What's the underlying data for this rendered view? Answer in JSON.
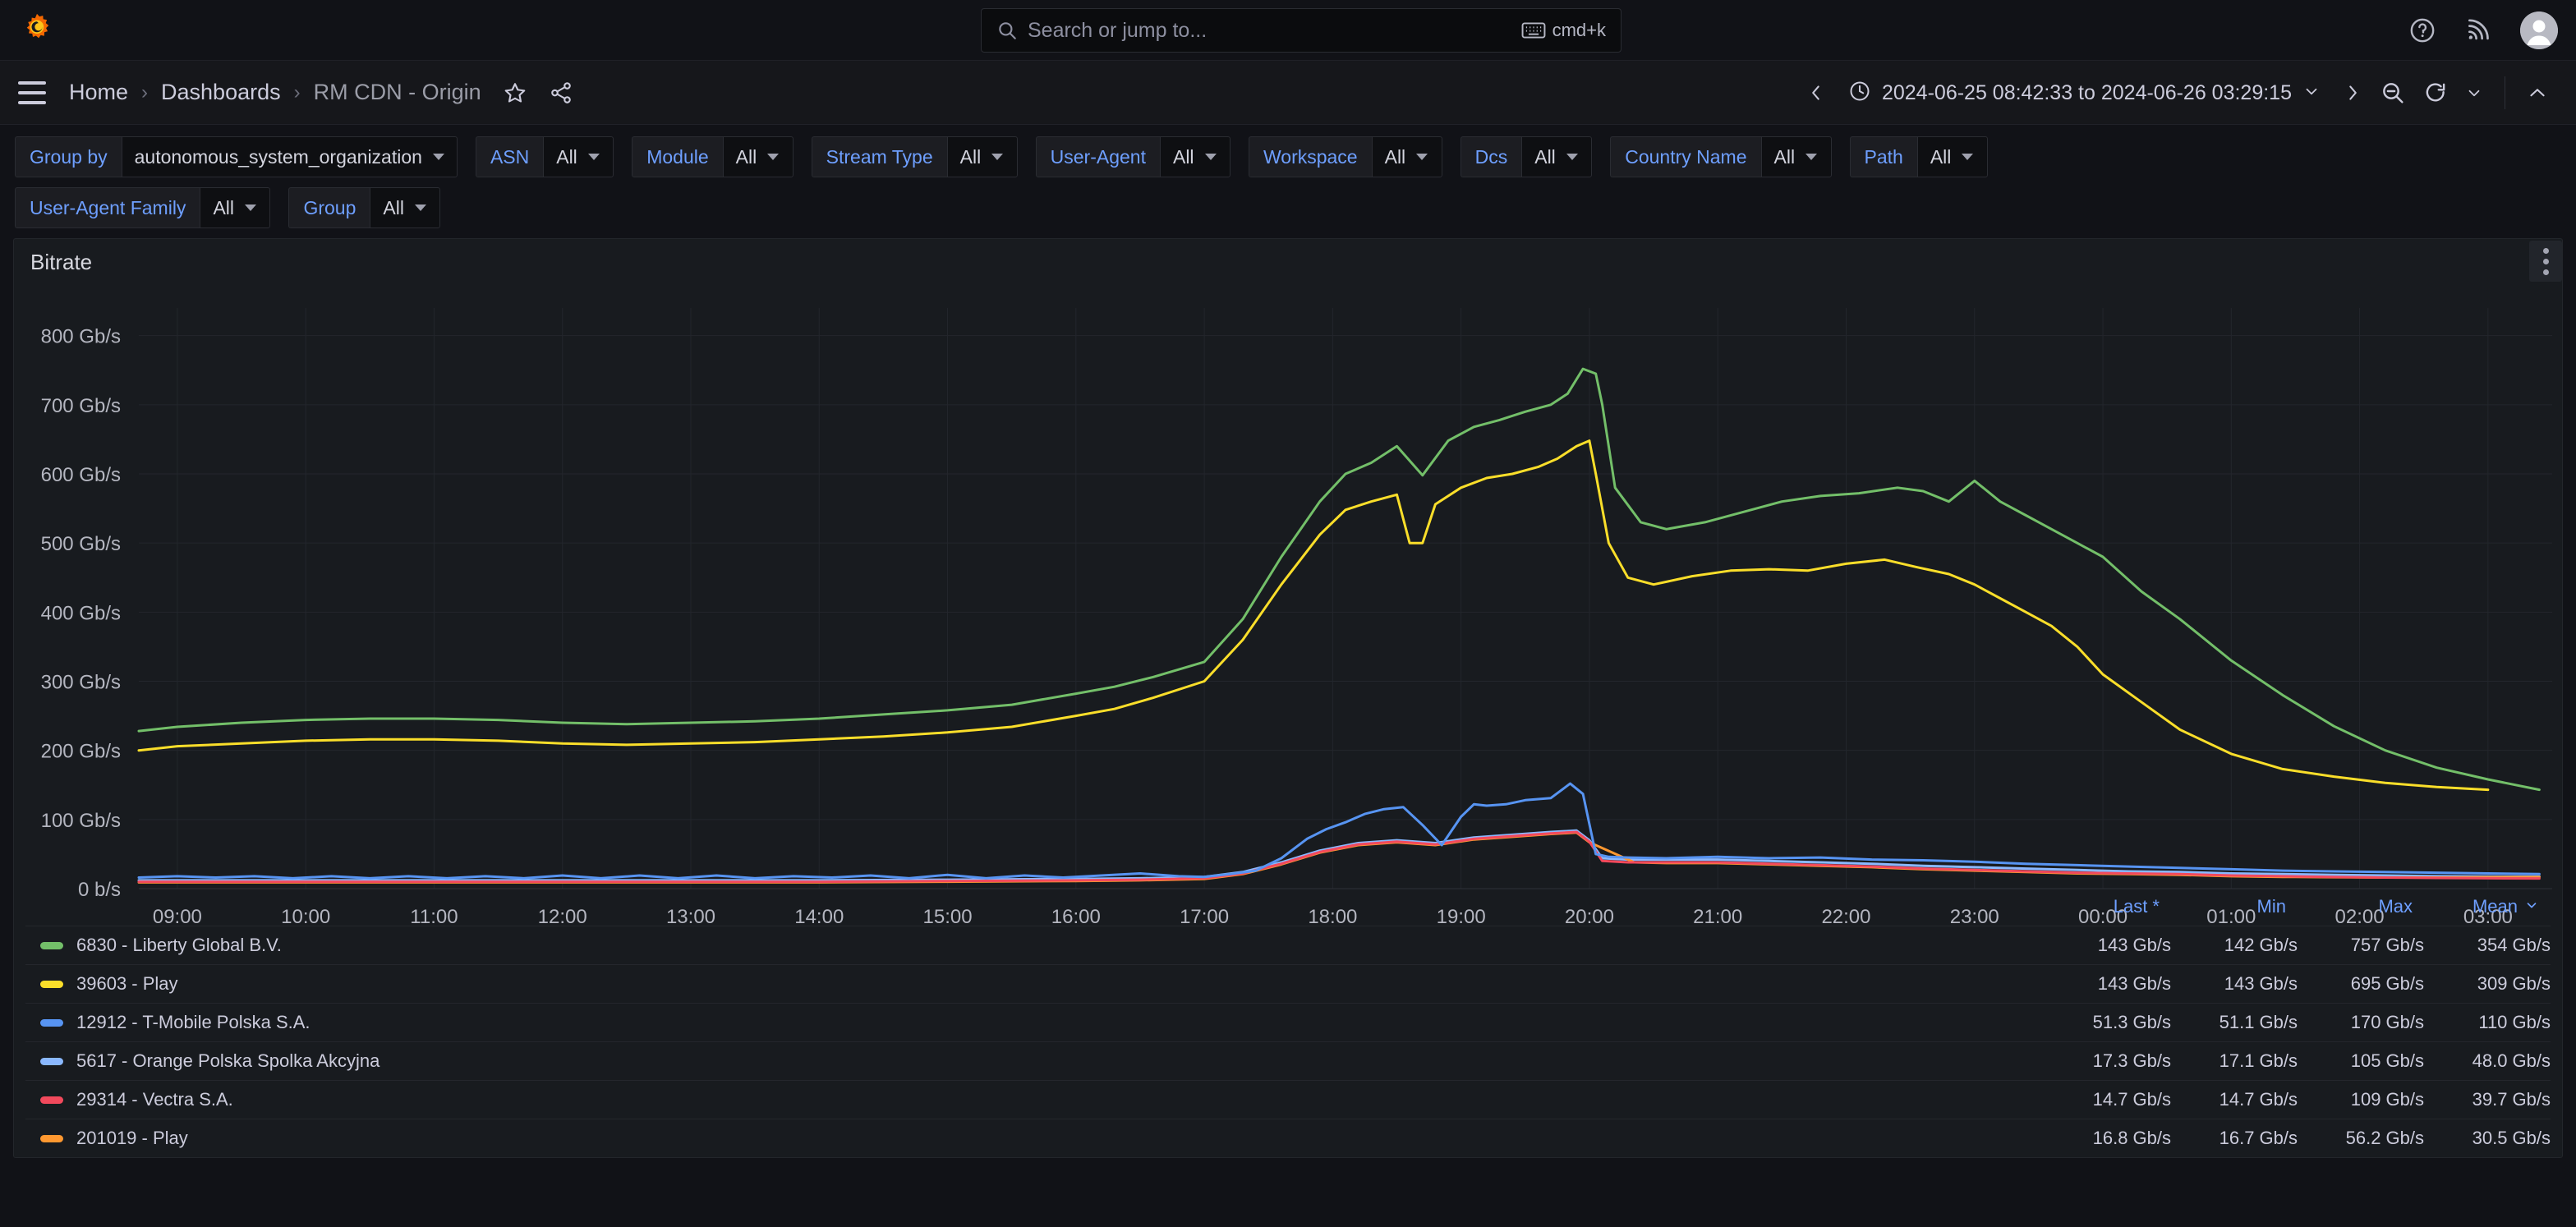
{
  "topnav": {
    "logo_icon": "grafana-logo-icon",
    "search": {
      "placeholder": "Search or jump to...",
      "shortcut": "cmd+k",
      "icon": "search-icon",
      "kbd_icon": "keyboard-icon"
    },
    "help_icon": "help-circle-icon",
    "news_icon": "rss-news-icon",
    "avatar_icon": "user-avatar-icon"
  },
  "breadcrumb": {
    "menu_icon": "hamburger-menu-icon",
    "items": [
      {
        "label": "Home"
      },
      {
        "label": "Dashboards"
      },
      {
        "label": "RM CDN - Origin"
      }
    ],
    "separator": "›",
    "star_icon": "star-outline-icon",
    "share_icon": "share-nodes-icon"
  },
  "timebar": {
    "prev_icon": "chevron-left-icon",
    "next_icon": "chevron-right-icon",
    "clock_icon": "clock-icon",
    "range": "2024-06-25 08:42:33 to 2024-06-26 03:29:15",
    "range_caret_icon": "chevron-down-icon",
    "zoom_out_icon": "zoom-out-icon",
    "refresh_icon": "refresh-icon",
    "refresh_caret_icon": "chevron-down-icon",
    "collapse_icon": "chevron-up-icon"
  },
  "variables": {
    "row1": [
      {
        "label": "Group by",
        "value": "autonomous_system_organization"
      },
      {
        "label": "ASN",
        "value": "All"
      },
      {
        "label": "Module",
        "value": "All"
      },
      {
        "label": "Stream Type",
        "value": "All"
      },
      {
        "label": "User-Agent",
        "value": "All"
      },
      {
        "label": "Workspace",
        "value": "All"
      },
      {
        "label": "Dcs",
        "value": "All"
      },
      {
        "label": "Country Name",
        "value": "All"
      },
      {
        "label": "Path",
        "value": "All"
      }
    ],
    "row2": [
      {
        "label": "User-Agent Family",
        "value": "All"
      },
      {
        "label": "Group",
        "value": "All"
      }
    ]
  },
  "panel": {
    "title": "Bitrate",
    "menu_icon": "panel-menu-kebab-icon"
  },
  "legend": {
    "columns": [
      "Last *",
      "Min",
      "Max",
      "Mean"
    ],
    "sort_caret_icon": "chevron-down-icon",
    "rows": [
      {
        "name": "6830 - Liberty Global B.V.",
        "color": "#73BF69",
        "last": "143 Gb/s",
        "min": "142 Gb/s",
        "max": "757 Gb/s",
        "mean": "354 Gb/s"
      },
      {
        "name": "39603 - Play",
        "color": "#FADE2A",
        "last": "143 Gb/s",
        "min": "143 Gb/s",
        "max": "695 Gb/s",
        "mean": "309 Gb/s"
      },
      {
        "name": "12912 - T-Mobile Polska S.A.",
        "color": "#5794F2",
        "last": "51.3 Gb/s",
        "min": "51.1 Gb/s",
        "max": "170 Gb/s",
        "mean": "110 Gb/s"
      },
      {
        "name": "5617 - Orange Polska Spolka Akcyjna",
        "color": "#8AB8FF",
        "last": "17.3 Gb/s",
        "min": "17.1 Gb/s",
        "max": "105 Gb/s",
        "mean": "48.0 Gb/s"
      },
      {
        "name": "29314 - Vectra S.A.",
        "color": "#F2495C",
        "last": "14.7 Gb/s",
        "min": "14.7 Gb/s",
        "max": "109 Gb/s",
        "mean": "39.7 Gb/s"
      },
      {
        "name": "201019 - Play",
        "color": "#FF9830",
        "last": "16.8 Gb/s",
        "min": "16.7 Gb/s",
        "max": "56.2 Gb/s",
        "mean": "30.5 Gb/s"
      }
    ]
  },
  "chart_data": {
    "type": "line",
    "title": "Bitrate",
    "xlabel": "",
    "ylabel": "",
    "grid": true,
    "legend_position": "bottom-table",
    "ylim": [
      0,
      840
    ],
    "ytick_labels": [
      "0 b/s",
      "100 Gb/s",
      "200 Gb/s",
      "300 Gb/s",
      "400 Gb/s",
      "500 Gb/s",
      "600 Gb/s",
      "700 Gb/s",
      "800 Gb/s"
    ],
    "ytick_values": [
      0,
      100,
      200,
      300,
      400,
      500,
      600,
      700,
      800
    ],
    "xtick_labels": [
      "09:00",
      "10:00",
      "11:00",
      "12:00",
      "13:00",
      "14:00",
      "15:00",
      "16:00",
      "17:00",
      "18:00",
      "19:00",
      "20:00",
      "21:00",
      "22:00",
      "23:00",
      "00:00",
      "01:00",
      "02:00",
      "03:00"
    ],
    "x_hours": [
      9,
      10,
      11,
      12,
      13,
      14,
      15,
      16,
      17,
      18,
      19,
      20,
      21,
      22,
      23,
      24,
      25,
      26,
      27
    ],
    "x_range_hours": [
      8.7,
      27.5
    ],
    "units": "Gb/s",
    "series": [
      {
        "name": "6830 - Liberty Global B.V.",
        "color": "#73BF69",
        "x": [
          8.7,
          9,
          9.5,
          10,
          10.5,
          11,
          11.5,
          12,
          12.5,
          13,
          13.5,
          14,
          14.5,
          15,
          15.5,
          16,
          16.3,
          16.6,
          17,
          17.3,
          17.6,
          17.9,
          18.1,
          18.3,
          18.5,
          18.7,
          18.9,
          19.1,
          19.3,
          19.5,
          19.7,
          19.83,
          19.95,
          20.05,
          20.1,
          20.2,
          20.4,
          20.6,
          20.9,
          21.2,
          21.5,
          21.8,
          22.1,
          22.4,
          22.6,
          22.8,
          23,
          23.2,
          23.4,
          23.6,
          23.8,
          24,
          24.3,
          24.6,
          25,
          25.4,
          25.8,
          26.2,
          26.6,
          27,
          27.4
        ],
        "y": [
          228,
          234,
          240,
          244,
          246,
          246,
          244,
          240,
          238,
          240,
          242,
          246,
          252,
          258,
          266,
          282,
          292,
          306,
          328,
          390,
          480,
          560,
          600,
          616,
          640,
          598,
          648,
          668,
          678,
          690,
          700,
          716,
          752,
          745,
          700,
          580,
          530,
          520,
          530,
          545,
          560,
          568,
          572,
          580,
          575,
          560,
          590,
          560,
          540,
          520,
          500,
          480,
          430,
          390,
          330,
          280,
          235,
          200,
          175,
          158,
          143
        ]
      },
      {
        "name": "39603 - Play",
        "color": "#FADE2A",
        "x": [
          8.7,
          9,
          9.5,
          10,
          10.5,
          11,
          11.5,
          12,
          12.5,
          13,
          13.5,
          14,
          14.5,
          15,
          15.5,
          16,
          16.3,
          16.6,
          17,
          17.3,
          17.6,
          17.9,
          18.1,
          18.3,
          18.5,
          18.6,
          18.7,
          18.8,
          19,
          19.2,
          19.4,
          19.6,
          19.75,
          19.9,
          20.0,
          20.05,
          20.15,
          20.3,
          20.5,
          20.8,
          21.1,
          21.4,
          21.7,
          22,
          22.3,
          22.55,
          22.8,
          23,
          23.2,
          23.4,
          23.6,
          23.8,
          24,
          24.3,
          24.6,
          25,
          25.4,
          25.8,
          26.2,
          26.6,
          27,
          27.4
        ],
        "y": [
          200,
          206,
          210,
          214,
          216,
          216,
          214,
          210,
          208,
          210,
          212,
          216,
          220,
          226,
          234,
          250,
          260,
          276,
          300,
          360,
          440,
          512,
          548,
          560,
          570,
          500,
          500,
          556,
          580,
          594,
          600,
          610,
          622,
          640,
          648,
          600,
          500,
          450,
          440,
          452,
          460,
          462,
          460,
          470,
          476,
          465,
          455,
          440,
          420,
          400,
          380,
          350,
          310,
          270,
          230,
          195,
          173,
          162,
          153,
          147,
          143
        ]
      },
      {
        "name": "12912 - T-Mobile Polska S.A.",
        "color": "#5794F2",
        "x": [
          8.7,
          9,
          9.3,
          9.6,
          9.9,
          10.2,
          10.5,
          10.8,
          11.1,
          11.4,
          11.7,
          12,
          12.3,
          12.6,
          12.9,
          13.2,
          13.5,
          13.8,
          14.1,
          14.4,
          14.7,
          15,
          15.3,
          15.6,
          15.9,
          16.2,
          16.5,
          16.8,
          17,
          17.2,
          17.4,
          17.6,
          17.8,
          17.95,
          18.1,
          18.25,
          18.4,
          18.55,
          18.7,
          18.85,
          19,
          19.1,
          19.2,
          19.35,
          19.5,
          19.7,
          19.85,
          19.95,
          20.05,
          20.15,
          20.3,
          20.6,
          21,
          21.4,
          21.8,
          22.2,
          22.6,
          23,
          23.4,
          23.8,
          24.2,
          24.6,
          25,
          25.4,
          25.8,
          26.2,
          26.6,
          27,
          27.4
        ],
        "y": [
          16,
          18,
          16,
          18,
          15,
          18,
          15,
          18,
          15,
          18,
          15,
          19,
          15,
          19,
          15,
          19,
          15,
          18,
          16,
          19,
          15,
          20,
          15,
          19,
          16,
          19,
          22,
          18,
          17,
          21,
          26,
          44,
          72,
          86,
          96,
          108,
          115,
          118,
          92,
          63,
          104,
          122,
          120,
          122,
          128,
          131,
          152,
          137,
          50,
          46,
          45,
          44,
          46,
          44,
          45,
          42,
          41,
          39,
          36,
          34,
          32,
          30,
          28,
          26,
          25,
          24,
          23,
          22,
          21
        ]
      },
      {
        "name": "5617 - Orange Polska Spolka Akcyjna",
        "color": "#8AB8FF",
        "x": [
          8.7,
          10,
          11,
          12,
          13,
          14,
          15,
          16,
          16.5,
          17,
          17.3,
          17.6,
          17.9,
          18.2,
          18.5,
          18.8,
          19.1,
          19.4,
          19.7,
          19.9,
          20.0,
          20.1,
          20.3,
          20.6,
          21,
          21.4,
          21.8,
          22.2,
          22.6,
          23,
          23.4,
          23.8,
          24.2,
          24.6,
          25,
          25.4,
          25.8,
          26.2,
          26.6,
          27,
          27.4
        ],
        "y": [
          12,
          12,
          12,
          12,
          12,
          12,
          13,
          14,
          15,
          17,
          24,
          38,
          55,
          66,
          70,
          66,
          74,
          78,
          82,
          84,
          70,
          44,
          42,
          42,
          42,
          40,
          38,
          36,
          33,
          31,
          29,
          27,
          25,
          24,
          22,
          21,
          20,
          19,
          18,
          17.5,
          17.3
        ]
      },
      {
        "name": "29314 - Vectra S.A.",
        "color": "#F2495C",
        "x": [
          8.7,
          10,
          11,
          12,
          13,
          14,
          15,
          16,
          16.5,
          17,
          17.3,
          17.6,
          17.9,
          18.2,
          18.5,
          18.8,
          19.1,
          19.4,
          19.7,
          19.9,
          20.0,
          20.1,
          20.3,
          20.6,
          21,
          21.4,
          21.8,
          22.2,
          22.6,
          23,
          23.4,
          23.8,
          24.2,
          24.6,
          25,
          25.4,
          25.8,
          26.2,
          26.6,
          27,
          27.4
        ],
        "y": [
          10,
          10,
          10,
          10,
          10,
          10,
          11,
          12,
          13,
          15,
          22,
          36,
          53,
          64,
          68,
          64,
          72,
          76,
          80,
          82,
          68,
          40,
          38,
          38,
          38,
          36,
          34,
          32,
          29,
          27,
          25,
          23,
          22,
          21,
          19,
          18,
          17,
          16,
          15.5,
          15,
          14.7
        ]
      },
      {
        "name": "201019 - Play",
        "color": "#FF9830",
        "x": [
          8.7,
          10,
          11,
          12,
          13,
          14,
          15,
          16,
          16.5,
          17,
          17.3,
          17.6,
          17.9,
          18.2,
          18.5,
          18.8,
          19.1,
          19.4,
          19.7,
          19.9,
          20.0,
          20.35,
          20.6,
          21,
          21.4,
          21.8,
          22.2,
          22.6,
          23,
          23.4,
          23.8,
          24.2,
          24.6,
          25,
          25.4,
          25.8,
          26.2,
          26.6,
          27,
          27.4
        ],
        "y": [
          9,
          9,
          9,
          9,
          9,
          9,
          10,
          11,
          12,
          14,
          21,
          35,
          52,
          63,
          67,
          63,
          71,
          75,
          79,
          81,
          67,
          38,
          37,
          37,
          35,
          33,
          31,
          28,
          26,
          24,
          22,
          21,
          20,
          18,
          17,
          16.5,
          16,
          16,
          16.5,
          16.8
        ]
      }
    ]
  }
}
